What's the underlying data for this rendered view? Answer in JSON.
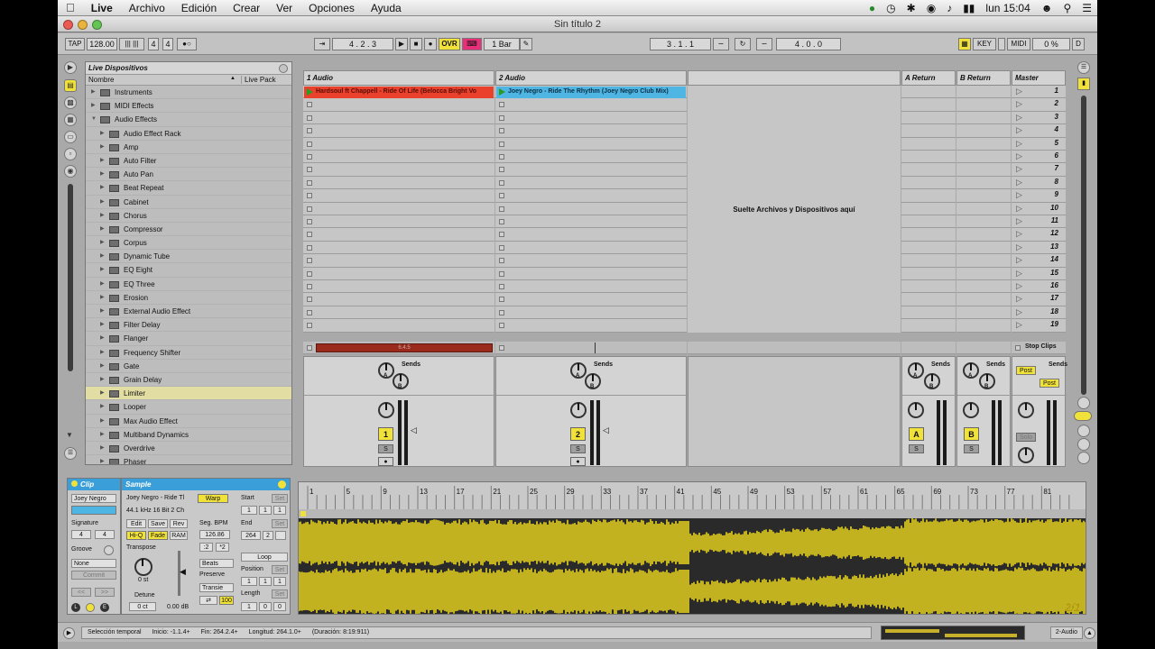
{
  "menu": {
    "app": "Live",
    "items": [
      "Archivo",
      "Edición",
      "Crear",
      "Ver",
      "Opciones",
      "Ayuda"
    ],
    "clock": "lun 15:04"
  },
  "window_title": "Sin título 2",
  "transport": {
    "tap": "TAP",
    "tempo": "128.00",
    "signature_num": "4",
    "signature_den": "4",
    "position": "4 .  2 .  3",
    "ovr": "OVR",
    "quantize": "1 Bar",
    "loop_start": "3 .  1 .  1",
    "loop_length": "4 .  0 .  0",
    "key": "KEY",
    "midi": "MIDI",
    "cpu": "0 %",
    "d": "D"
  },
  "browser": {
    "title": "Live Dispositivos",
    "col_name": "Nombre",
    "col_pack": "Live Pack",
    "folders": [
      "Instruments",
      "MIDI Effects",
      "Audio Effects"
    ],
    "effects": [
      "Audio Effect Rack",
      "Amp",
      "Auto Filter",
      "Auto Pan",
      "Beat Repeat",
      "Cabinet",
      "Chorus",
      "Compressor",
      "Corpus",
      "Dynamic Tube",
      "EQ Eight",
      "EQ Three",
      "Erosion",
      "External Audio Effect",
      "Filter Delay",
      "Flanger",
      "Frequency Shifter",
      "Gate",
      "Grain Delay",
      "Limiter",
      "Looper",
      "Max Audio Effect",
      "Multiband Dynamics",
      "Overdrive",
      "Phaser"
    ],
    "selected": "Limiter"
  },
  "session": {
    "tracks": [
      {
        "name": "1 Audio",
        "clip": "Hardsoul ft Chappell - Ride Of Life (Belocca Bright Vo",
        "clip_color": "#e9412c",
        "num": "1"
      },
      {
        "name": "2 Audio",
        "clip": "Joey Negro - Ride The Rhythm (Joey Negro Club Mix)",
        "clip_color": "#4fb6e3",
        "num": "2"
      }
    ],
    "drop_hint": "Suelte Archivos y Dispositivos aquí",
    "returns": [
      {
        "name": "A Return",
        "btn": "A"
      },
      {
        "name": "B Return",
        "btn": "B"
      }
    ],
    "master": "Master",
    "scenes": [
      "1",
      "2",
      "3",
      "4",
      "5",
      "6",
      "7",
      "8",
      "9",
      "10",
      "11",
      "12",
      "13",
      "14",
      "15",
      "16",
      "17",
      "18",
      "19"
    ],
    "stop_clips": "Stop Clips",
    "sends": "Sends",
    "post": "Post",
    "solo": "Solo",
    "s": "S",
    "track1_playing": "6.4.5"
  },
  "detail": {
    "clip_title": "Clip",
    "clip_name": "Joey Negro",
    "signature": "Signature",
    "sig_num": "4",
    "sig_den": "4",
    "groove": "Groove",
    "groove_val": "None",
    "commit": "Commit",
    "sample_title": "Sample",
    "sample_name": "Joey Negro - Ride Tl",
    "sample_info": "44.1 kHz 16 Bit 2 Ch",
    "edit": "Edit",
    "save": "Save",
    "rev": "Rev",
    "hiq": "Hi-Q",
    "fade": "Fade",
    "ram": "RAM",
    "transpose": "Transpose",
    "transpose_val": "0 st",
    "detune": "Detune",
    "detune_val": "0 ct",
    "gain": "0.00 dB",
    "warp": "Warp",
    "seg_bpm": "Seg. BPM",
    "bpm": "126.86",
    "half": ":2",
    "double": "*2",
    "warp_mode": "Beats",
    "preserve": "Preserve",
    "transients": "Transie",
    "hundred": "100",
    "start": "Start",
    "end": "End",
    "end_val": "264",
    "end_val2": "2",
    "loop": "Loop",
    "position": "Position",
    "length": "Length",
    "set": "Set",
    "one": "1",
    "zero": "0",
    "ruler": [
      "1",
      "5",
      "9",
      "13",
      "17",
      "21",
      "25",
      "29",
      "33",
      "37",
      "41",
      "45",
      "49",
      "53",
      "57",
      "61",
      "65",
      "69",
      "73",
      "77",
      "81"
    ],
    "ratio": "2/1"
  },
  "status": {
    "mode": "Selección temporal",
    "start": "Inicio: -1.1.4+",
    "end": "Fin: 264.2.4+",
    "length": "Longitud: 264.1.0+",
    "duration": "(Duración: 8:19:911)",
    "track": "2-Audio"
  }
}
